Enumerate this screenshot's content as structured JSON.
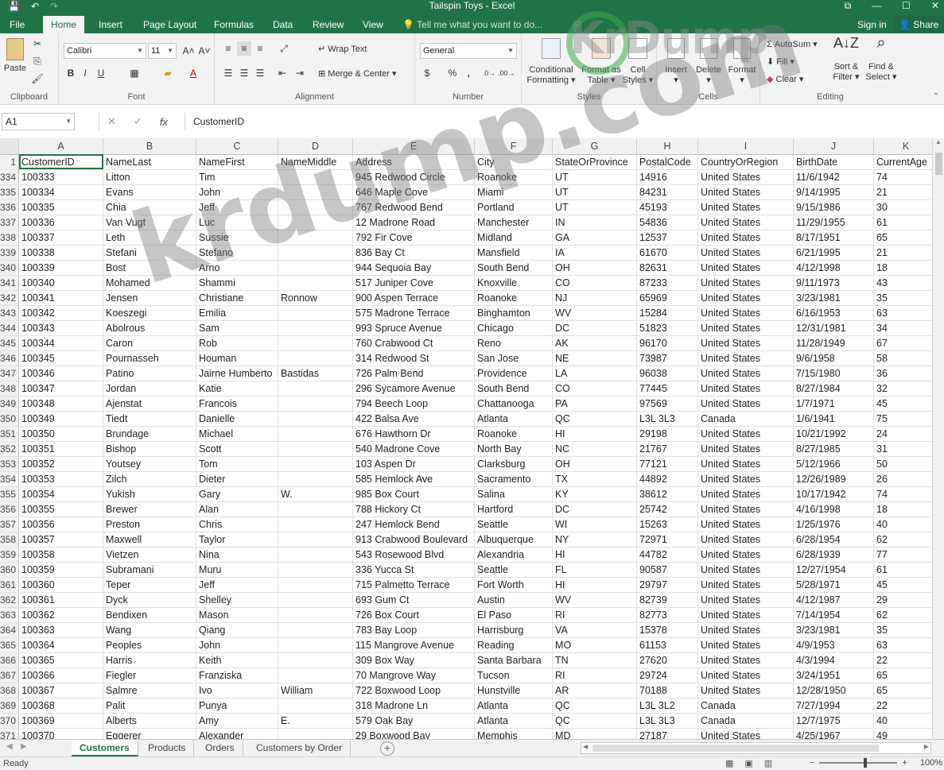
{
  "window": {
    "title": "Tailspin Toys - Excel",
    "minimize": "—",
    "maximize": "☐",
    "close": "✕",
    "restore": "⧉"
  },
  "tabs": [
    {
      "label": "File"
    },
    {
      "label": "Home"
    },
    {
      "label": "Insert"
    },
    {
      "label": "Page Layout"
    },
    {
      "label": "Formulas"
    },
    {
      "label": "Data"
    },
    {
      "label": "Review"
    },
    {
      "label": "View"
    }
  ],
  "tell_me": "Tell me what you want to do...",
  "sign_in": "Sign in",
  "share": "Share",
  "ribbon": {
    "clipboard": {
      "label": "Clipboard",
      "paste": "Paste"
    },
    "font": {
      "label": "Font",
      "name": "Calibri",
      "size": "11",
      "bold": "B",
      "italic": "I",
      "underline": "U"
    },
    "alignment": {
      "label": "Alignment",
      "wrap_text": "Wrap Text",
      "merge_center": "Merge & Center"
    },
    "number": {
      "label": "Number",
      "format": "General",
      "currency": "$",
      "percent": "%",
      "comma": ","
    },
    "styles": {
      "label": "Styles",
      "conditional_1": "Conditional",
      "conditional_2": "Formatting",
      "format_table_1": "Format as",
      "format_table_2": "Table",
      "cell_styles_1": "Cell",
      "cell_styles_2": "Styles"
    },
    "cells": {
      "label": "Cells",
      "insert": "Insert",
      "delete": "Delete",
      "format": "Format"
    },
    "editing": {
      "label": "Editing",
      "autosum": "AutoSum",
      "fill": "Fill",
      "clear": "Clear",
      "sort_1": "Sort &",
      "sort_2": "Filter",
      "find_1": "Find &",
      "find_2": "Select"
    }
  },
  "formula_bar": {
    "name_box": "A1",
    "cancel": "✕",
    "enter": "✓",
    "fx": "fx",
    "content": "CustomerID"
  },
  "columns": [
    "A",
    "B",
    "C",
    "D",
    "E",
    "F",
    "G",
    "H",
    "I",
    "J",
    "K"
  ],
  "header_row": {
    "num": "1",
    "cells": [
      "CustomerID",
      "NameLast",
      "NameFirst",
      "NameMiddle",
      "Address",
      "City",
      "StateOrProvince",
      "PostalCode",
      "CountryOrRegion",
      "BirthDate",
      "CurrentAge"
    ]
  },
  "rows": [
    {
      "num": "334",
      "cells": [
        "100333",
        "Litton",
        "Tim",
        "",
        "945 Redwood Circle",
        "Roanoke",
        "UT",
        "14916",
        "United States",
        "11/6/1942",
        "74"
      ]
    },
    {
      "num": "335",
      "cells": [
        "100334",
        "Evans",
        "John",
        "",
        "646 Maple Cove",
        "Miami",
        "UT",
        "84231",
        "United States",
        "9/14/1995",
        "21"
      ]
    },
    {
      "num": "336",
      "cells": [
        "100335",
        "Chia",
        "Jeff",
        "",
        "767 Redwood Bend",
        "Portland",
        "UT",
        "45193",
        "United States",
        "9/15/1986",
        "30"
      ]
    },
    {
      "num": "337",
      "cells": [
        "100336",
        "Van Vugt",
        "Luc",
        "",
        "12 Madrone Road",
        "Manchester",
        "IN",
        "54836",
        "United States",
        "11/29/1955",
        "61"
      ]
    },
    {
      "num": "338",
      "cells": [
        "100337",
        "Leth",
        "Sussie",
        "",
        "792 Fir Cove",
        "Midland",
        "GA",
        "12537",
        "United States",
        "8/17/1951",
        "65"
      ]
    },
    {
      "num": "339",
      "cells": [
        "100338",
        "Stefani",
        "Stefano",
        "",
        "836 Bay Ct",
        "Mansfield",
        "IA",
        "61670",
        "United States",
        "6/21/1995",
        "21"
      ]
    },
    {
      "num": "340",
      "cells": [
        "100339",
        "Bost",
        "Arno",
        "",
        "944 Sequoia Bay",
        "South Bend",
        "OH",
        "82631",
        "United States",
        "4/12/1998",
        "18"
      ]
    },
    {
      "num": "341",
      "cells": [
        "100340",
        "Mohamed",
        "Shammi",
        "",
        "517 Juniper Cove",
        "Knoxville",
        "CO",
        "87233",
        "United States",
        "9/11/1973",
        "43"
      ]
    },
    {
      "num": "342",
      "cells": [
        "100341",
        "Jensen",
        "Christiane",
        "Ronnow",
        "900 Aspen Terrace",
        "Roanoke",
        "NJ",
        "65969",
        "United States",
        "3/23/1981",
        "35"
      ]
    },
    {
      "num": "343",
      "cells": [
        "100342",
        "Koeszegi",
        "Emilia",
        "",
        "575 Madrone Terrace",
        "Binghamton",
        "WV",
        "15284",
        "United States",
        "6/16/1953",
        "63"
      ]
    },
    {
      "num": "344",
      "cells": [
        "100343",
        "Abolrous",
        "Sam",
        "",
        "993 Spruce Avenue",
        "Chicago",
        "DC",
        "51823",
        "United States",
        "12/31/1981",
        "34"
      ]
    },
    {
      "num": "345",
      "cells": [
        "100344",
        "Caron",
        "Rob",
        "",
        "760 Crabwood Ct",
        "Reno",
        "AK",
        "96170",
        "United States",
        "11/28/1949",
        "67"
      ]
    },
    {
      "num": "346",
      "cells": [
        "100345",
        "Pournasseh",
        "Houman",
        "",
        "314 Redwood St",
        "San Jose",
        "NE",
        "73987",
        "United States",
        "9/6/1958",
        "58"
      ]
    },
    {
      "num": "347",
      "cells": [
        "100346",
        "Patino",
        "Jairne Humberto",
        "Bastidas",
        "726 Palm Bend",
        "Providence",
        "LA",
        "96038",
        "United States",
        "7/15/1980",
        "36"
      ]
    },
    {
      "num": "348",
      "cells": [
        "100347",
        "Jordan",
        "Katie",
        "",
        "296 Sycamore Avenue",
        "South Bend",
        "CO",
        "77445",
        "United States",
        "8/27/1984",
        "32"
      ]
    },
    {
      "num": "349",
      "cells": [
        "100348",
        "Ajenstat",
        "Francois",
        "",
        "794 Beech Loop",
        "Chattanooga",
        "PA",
        "97569",
        "United States",
        "1/7/1971",
        "45"
      ]
    },
    {
      "num": "350",
      "cells": [
        "100349",
        "Tiedt",
        "Danielle",
        "",
        "422 Balsa Ave",
        "Atlanta",
        "QC",
        "L3L 3L3",
        "Canada",
        "1/6/1941",
        "75"
      ]
    },
    {
      "num": "351",
      "cells": [
        "100350",
        "Brundage",
        "Michael",
        "",
        "676 Hawthorn Dr",
        "Roanoke",
        "HI",
        "29198",
        "United States",
        "10/21/1992",
        "24"
      ]
    },
    {
      "num": "352",
      "cells": [
        "100351",
        "Bishop",
        "Scott",
        "",
        "540 Madrone Cove",
        "North Bay",
        "NC",
        "21767",
        "United States",
        "8/27/1985",
        "31"
      ]
    },
    {
      "num": "353",
      "cells": [
        "100352",
        "Youtsey",
        "Tom",
        "",
        "103 Aspen Dr",
        "Clarksburg",
        "OH",
        "77121",
        "United States",
        "5/12/1966",
        "50"
      ]
    },
    {
      "num": "354",
      "cells": [
        "100353",
        "Zilch",
        "Dieter",
        "",
        "585 Hemlock Ave",
        "Sacramento",
        "TX",
        "44892",
        "United States",
        "12/26/1989",
        "26"
      ]
    },
    {
      "num": "355",
      "cells": [
        "100354",
        "Yukish",
        "Gary",
        "W.",
        "985 Box Court",
        "Salina",
        "KY",
        "38612",
        "United States",
        "10/17/1942",
        "74"
      ]
    },
    {
      "num": "356",
      "cells": [
        "100355",
        "Brewer",
        "Alan",
        "",
        "788 Hickory Ct",
        "Hartford",
        "DC",
        "25742",
        "United States",
        "4/16/1998",
        "18"
      ]
    },
    {
      "num": "357",
      "cells": [
        "100356",
        "Preston",
        "Chris",
        "",
        "247 Hemlock Bend",
        "Seattle",
        "WI",
        "15263",
        "United States",
        "1/25/1976",
        "40"
      ]
    },
    {
      "num": "358",
      "cells": [
        "100357",
        "Maxwell",
        "Taylor",
        "",
        "913 Crabwood Boulevard",
        "Albuquerque",
        "NY",
        "72971",
        "United States",
        "6/28/1954",
        "62"
      ]
    },
    {
      "num": "359",
      "cells": [
        "100358",
        "Vietzen",
        "Nina",
        "",
        "543 Rosewood Blvd",
        "Alexandria",
        "HI",
        "44782",
        "United States",
        "6/28/1939",
        "77"
      ]
    },
    {
      "num": "360",
      "cells": [
        "100359",
        "Subramani",
        "Muru",
        "",
        "336 Yucca St",
        "Seattle",
        "FL",
        "90587",
        "United States",
        "12/27/1954",
        "61"
      ]
    },
    {
      "num": "361",
      "cells": [
        "100360",
        "Teper",
        "Jeff",
        "",
        "715 Palmetto Terrace",
        "Fort Worth",
        "HI",
        "29797",
        "United States",
        "5/28/1971",
        "45"
      ]
    },
    {
      "num": "362",
      "cells": [
        "100361",
        "Dyck",
        "Shelley",
        "",
        "693 Gum Ct",
        "Austin",
        "WV",
        "82739",
        "United States",
        "4/12/1987",
        "29"
      ]
    },
    {
      "num": "363",
      "cells": [
        "100362",
        "Bendixen",
        "Mason",
        "",
        "726 Box Court",
        "El Paso",
        "RI",
        "82773",
        "United States",
        "7/14/1954",
        "62"
      ]
    },
    {
      "num": "364",
      "cells": [
        "100363",
        "Wang",
        "Qiang",
        "",
        "783 Bay Loop",
        "Harrisburg",
        "VA",
        "15378",
        "United States",
        "3/23/1981",
        "35"
      ]
    },
    {
      "num": "365",
      "cells": [
        "100364",
        "Peoples",
        "John",
        "",
        "115 Mangrove Avenue",
        "Reading",
        "MO",
        "61153",
        "United States",
        "4/9/1953",
        "63"
      ]
    },
    {
      "num": "366",
      "cells": [
        "100365",
        "Harris",
        "Keith",
        "",
        "309 Box Way",
        "Santa Barbara",
        "TN",
        "27620",
        "United States",
        "4/3/1994",
        "22"
      ]
    },
    {
      "num": "367",
      "cells": [
        "100366",
        "Fiegler",
        "Franziska",
        "",
        "70 Mangrove Way",
        "Tucson",
        "RI",
        "29724",
        "United States",
        "3/24/1951",
        "65"
      ]
    },
    {
      "num": "368",
      "cells": [
        "100367",
        "Salmre",
        "Ivo",
        "William",
        "722 Boxwood Loop",
        "Hunstville",
        "AR",
        "70188",
        "United States",
        "12/28/1950",
        "65"
      ]
    },
    {
      "num": "369",
      "cells": [
        "100368",
        "Palit",
        "Punya",
        "",
        "318 Madrone Ln",
        "Atlanta",
        "QC",
        "L3L 3L2",
        "Canada",
        "7/27/1994",
        "22"
      ]
    },
    {
      "num": "370",
      "cells": [
        "100369",
        "Alberts",
        "Amy",
        "E.",
        "579 Oak Bay",
        "Atlanta",
        "QC",
        "L3L 3L3",
        "Canada",
        "12/7/1975",
        "40"
      ]
    },
    {
      "num": "371",
      "cells": [
        "100370",
        "Eggerer",
        "Alexander",
        "",
        "29 Boxwood Bay",
        "Memphis",
        "MD",
        "27187",
        "United States",
        "4/25/1967",
        "49"
      ]
    }
  ],
  "sheet_tabs": [
    {
      "label": "Customers"
    },
    {
      "label": "Products"
    },
    {
      "label": "Orders"
    },
    {
      "label": "Customers by Order"
    }
  ],
  "add_sheet": "+",
  "status": {
    "ready": "Ready",
    "zoom": "100%",
    "zoom_minus": "−",
    "zoom_plus": "+"
  },
  "watermark": {
    "top": "KrDump",
    "diagonal": "krdump.com"
  }
}
